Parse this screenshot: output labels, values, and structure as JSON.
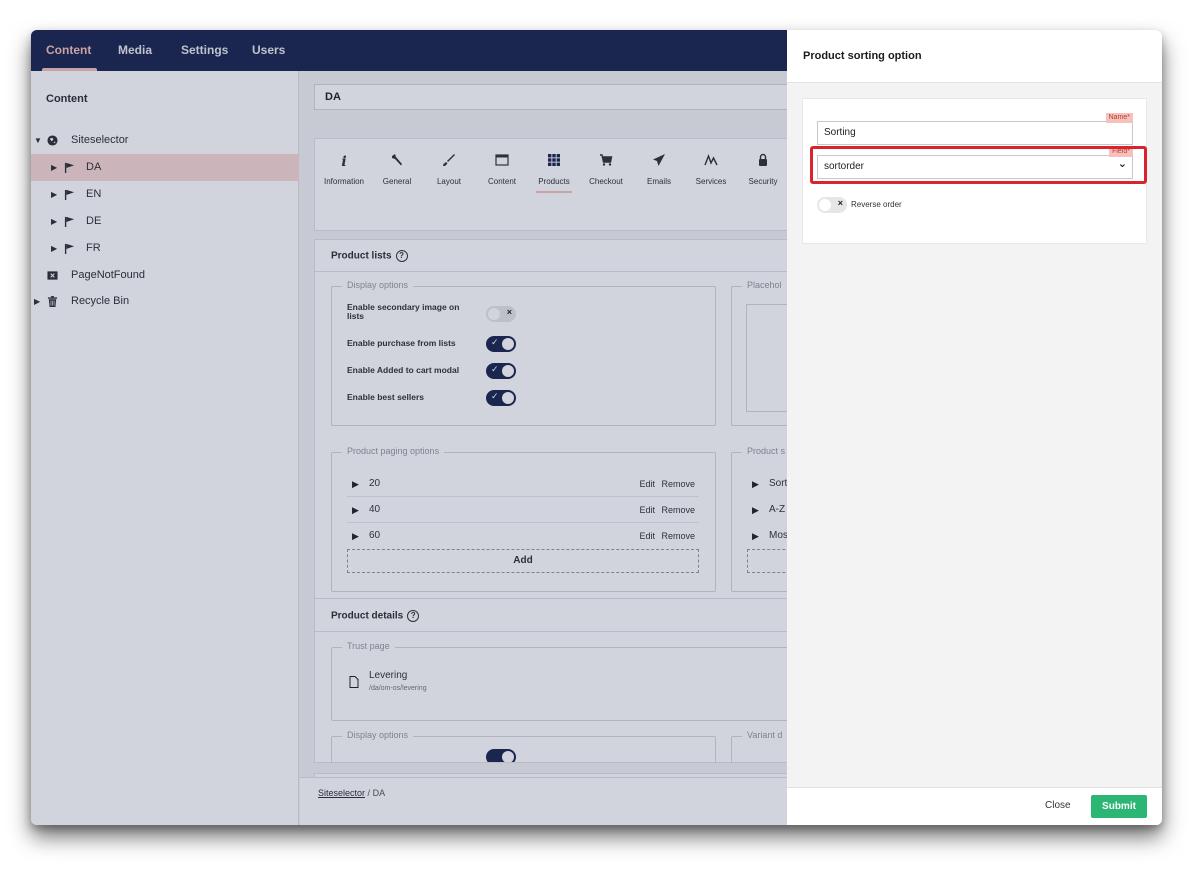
{
  "topnav": {
    "content": "Content",
    "media": "Media",
    "settings": "Settings",
    "users": "Users"
  },
  "tree": {
    "header": "Content",
    "items": [
      {
        "label": "Siteselector"
      },
      {
        "label": "DA"
      },
      {
        "label": "EN"
      },
      {
        "label": "DE"
      },
      {
        "label": "FR"
      },
      {
        "label": "PageNotFound"
      },
      {
        "label": "Recycle Bin"
      }
    ]
  },
  "main": {
    "node_name": "DA",
    "tabs": [
      "Information",
      "General",
      "Layout",
      "Content",
      "Products",
      "Checkout",
      "Emails",
      "Services",
      "Security"
    ],
    "active_tab": "Products",
    "product_lists": {
      "title": "Product lists",
      "display_options_legend": "Display options",
      "placeholder_legend_cut": "Placehol",
      "options": [
        {
          "label": "Enable secondary image on lists",
          "enabled": false
        },
        {
          "label": "Enable purchase from lists",
          "enabled": true
        },
        {
          "label": "Enable Added to cart modal",
          "enabled": true
        },
        {
          "label": "Enable best sellers",
          "enabled": true
        }
      ],
      "paging_legend": "Product paging options",
      "sorting_legend_cut": "Product s",
      "paging_rows": [
        "20",
        "40",
        "60"
      ],
      "edit_label": "Edit",
      "remove_label": "Remove",
      "add_label": "Add",
      "sorting_rows_cut": [
        "Sort",
        "A-Z",
        "Mos"
      ]
    },
    "product_details": {
      "title": "Product details",
      "trust_page_legend": "Trust page",
      "trust_page_name": "Levering",
      "trust_page_path": "/da/om-os/levering",
      "display_options_legend": "Display options",
      "variant_legend_cut": "Variant d"
    }
  },
  "breadcrumb": {
    "root": "Siteselector",
    "separator": "/",
    "current": "DA"
  },
  "dialog": {
    "title": "Product sorting option",
    "name_label": "Name*",
    "name_value": "Sorting",
    "field_label": "Field*",
    "field_value": "sortorder",
    "reverse_label": "Reverse order",
    "reverse_enabled": false,
    "close_label": "Close",
    "submit_label": "Submit"
  },
  "colors": {
    "topbar": "#1b264f",
    "accent": "#f5c1bc",
    "submit": "#2bb673",
    "highlight": "#d9232d"
  }
}
